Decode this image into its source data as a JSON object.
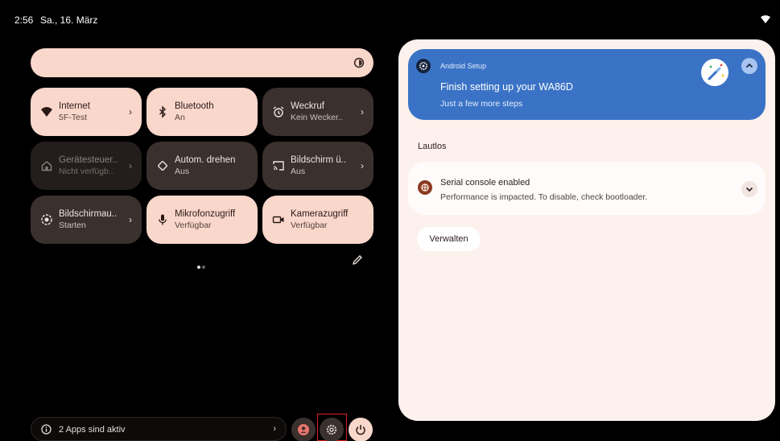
{
  "status_bar": {
    "time": "2:56",
    "date": "Sa., 16. März",
    "icons": [
      "wifi-icon"
    ]
  },
  "quick_settings": {
    "brightness_icon": "brightness-icon",
    "tiles": [
      {
        "title": "Internet",
        "subtitle": "5F-Test",
        "icon": "wifi-icon",
        "state": "on",
        "has_chevron": true
      },
      {
        "title": "Bluetooth",
        "subtitle": "An",
        "icon": "bluetooth-icon",
        "state": "on",
        "has_chevron": false
      },
      {
        "title": "Weckruf",
        "subtitle": "Kein Wecker..",
        "icon": "alarm-icon",
        "state": "off",
        "has_chevron": true
      },
      {
        "title": "Gerätesteuer..",
        "subtitle": "Nicht verfügb..",
        "icon": "home-icon",
        "state": "dim",
        "has_chevron": true
      },
      {
        "title": "Autom. drehen",
        "subtitle": "Aus",
        "icon": "rotate-icon",
        "state": "off",
        "has_chevron": false
      },
      {
        "title": "Bildschirm ü..",
        "subtitle": "Aus",
        "icon": "cast-icon",
        "state": "off",
        "has_chevron": true
      },
      {
        "title": "Bildschirmau..",
        "subtitle": "Starten",
        "icon": "screen-record-icon",
        "state": "off",
        "has_chevron": true
      },
      {
        "title": "Mikrofonzugriff",
        "subtitle": "Verfügbar",
        "icon": "microphone-icon",
        "state": "on",
        "has_chevron": false
      },
      {
        "title": "Kamerazugriff",
        "subtitle": "Verfügbar",
        "icon": "camera-icon",
        "state": "on",
        "has_chevron": false
      }
    ],
    "pager": {
      "pages": 2,
      "current": 1
    },
    "edit_icon": "pencil-icon"
  },
  "footer": {
    "apps_active": "2 Apps sind aktiv",
    "buttons": [
      "user-icon",
      "settings-icon",
      "power-icon"
    ]
  },
  "notifications": {
    "setup": {
      "app_name": "Android Setup",
      "title": "Finish setting up your WA86D",
      "subtitle": "Just a few more steps"
    },
    "silent_header": "Lautlos",
    "serial": {
      "title": "Serial console enabled",
      "text": "Performance is impacted. To disable, check bootloader."
    },
    "manage_label": "Verwalten"
  },
  "colors": {
    "tile_on": "#fad7cb",
    "tile_off": "#3a302d",
    "tile_dim": "#231d1b",
    "setup_card": "#3a73c6",
    "panel": "#fcf1ed",
    "highlight": "#e21b1b"
  }
}
